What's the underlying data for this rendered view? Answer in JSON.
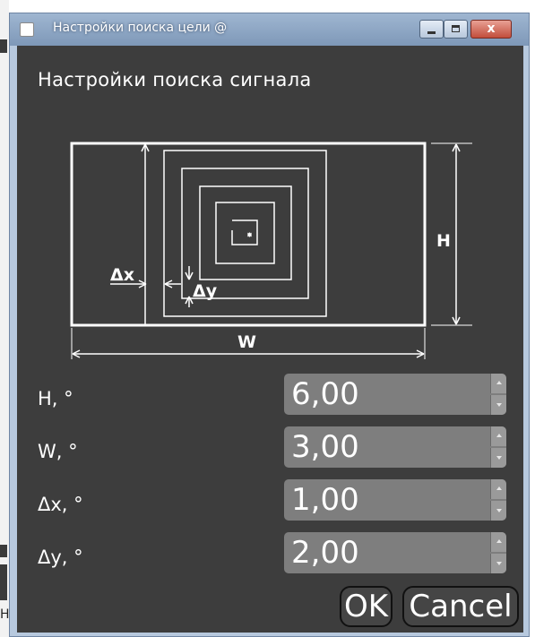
{
  "window": {
    "title": "Настройки поиска цели @",
    "close_glyph": "x"
  },
  "dialog": {
    "heading": "Настройки поиска сигнала"
  },
  "diagram": {
    "labels": {
      "h": "H",
      "w": "W",
      "dx": "Δx",
      "dy": "Δy"
    }
  },
  "fields": [
    {
      "label": "H, °",
      "value": "6,00"
    },
    {
      "label": "W, °",
      "value": "3,00"
    },
    {
      "label": "Δx, °",
      "value": "1,00"
    },
    {
      "label": "Δy, °",
      "value": "2,00"
    }
  ],
  "buttons": {
    "ok": "OK",
    "cancel": "Cancel"
  },
  "background_fragment": {
    "char": "Н"
  }
}
